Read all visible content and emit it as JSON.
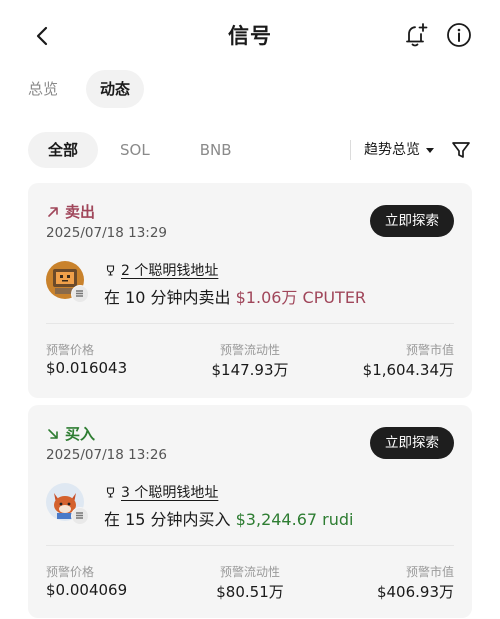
{
  "header": {
    "title": "信号",
    "back_icon": "chevron-left-icon",
    "bell_icon": "bell-plus-icon",
    "info_icon": "info-icon"
  },
  "tabs": [
    {
      "label": "总览",
      "active": false
    },
    {
      "label": "动态",
      "active": true
    }
  ],
  "filters": {
    "chips": [
      {
        "label": "全部",
        "active": true
      },
      {
        "label": "SOL",
        "active": false
      },
      {
        "label": "BNB",
        "active": false
      }
    ],
    "trend_label": "趋势总览",
    "filter_icon": "funnel-icon"
  },
  "cards": [
    {
      "direction": "卖出",
      "direction_color": "#a0465a",
      "time": "2025/07/18 13:29",
      "button": "立即探索",
      "smart_count": "2 个聪明钱地址",
      "desc_prefix": "在 10 分钟内卖出 ",
      "desc_amount": "$1.06万 CPUTER",
      "labels": {
        "price": "预警价格",
        "liquidity": "预警流动性",
        "mcap": "预警市值"
      },
      "price": "$0.016043",
      "liquidity": "$147.93万",
      "mcap": "$1,604.34万"
    },
    {
      "direction": "买入",
      "direction_color": "#2e7d32",
      "time": "2025/07/18 13:26",
      "button": "立即探索",
      "smart_count": "3 个聪明钱地址",
      "desc_prefix": "在 15 分钟内买入 ",
      "desc_amount": "$3,244.67 rudi",
      "labels": {
        "price": "预警价格",
        "liquidity": "预警流动性",
        "mcap": "预警市值"
      },
      "price": "$0.004069",
      "liquidity": "$80.51万",
      "mcap": "$406.93万"
    }
  ]
}
